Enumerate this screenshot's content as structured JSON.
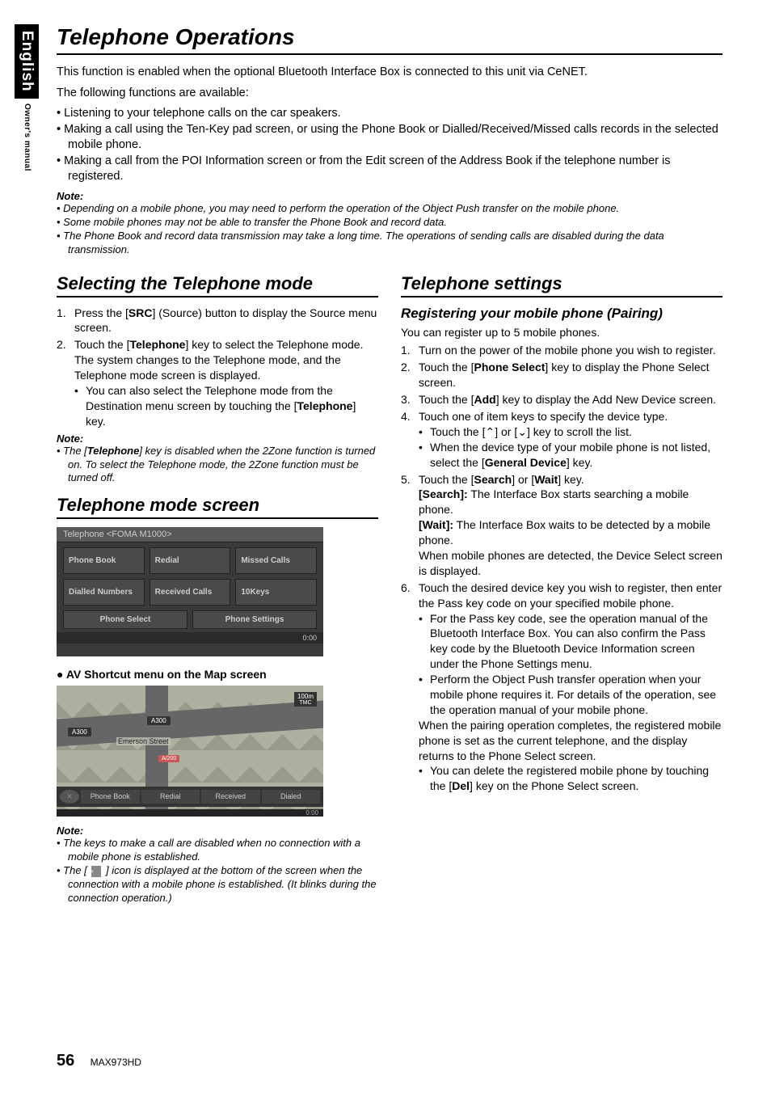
{
  "sidebar": {
    "english": "English",
    "owner": "Owner's manual"
  },
  "title": "Telephone Operations",
  "intro_l1": "This function is enabled when the optional Bluetooth Interface Box is connected to this unit via CeNET.",
  "intro_l2": "The following functions are available:",
  "top_bullets": [
    "Listening to your telephone calls on the car speakers.",
    "Making a call using the Ten-Key pad screen, or using the Phone Book or Dialled/Received/Missed calls records in the selected mobile phone.",
    "Making a call from the POI Information screen or from the Edit screen of the Address Book if the telephone number is registered."
  ],
  "note_label": "Note:",
  "top_notes": [
    "Depending on a mobile phone, you may need to perform the operation of the Object Push transfer on the mobile phone.",
    "Some mobile phones may not be able to transfer the Phone Book and record data.",
    "The Phone Book and record data transmission may take a long time. The operations of sending calls are disabled during the data transmission."
  ],
  "left": {
    "h2a": "Selecting the Telephone mode",
    "step1_pre": "Press the [",
    "step1_key": "SRC",
    "step1_post": "] (Source) button to display the Source menu screen.",
    "step2_pre": "Touch the [",
    "step2_key": "Telephone",
    "step2_post": "] key to select the Telephone mode.",
    "step2_body": "The system changes to the Telephone mode, and the Telephone mode screen is displayed.",
    "step2_sub_pre": "You can also select the Telephone mode from the Destination menu screen by touching the [",
    "step2_sub_key": "Telephone",
    "step2_sub_post": "] key.",
    "note1_pre": "The [",
    "note1_key": "Telephone",
    "note1_post": "] key is disabled when the 2Zone function is turned on. To select the Telephone mode, the 2Zone function must be turned off.",
    "h2b": "Telephone mode screen",
    "tel_shot": {
      "titlebar": "Telephone <FOMA M1000>",
      "cells": [
        "Phone Book",
        "Redial",
        "Missed Calls",
        "Dialled Numbers",
        "Received Calls",
        "10Keys"
      ],
      "bottom": [
        "Phone Select",
        "Phone Settings"
      ],
      "time": "0:00"
    },
    "shortcut_h": "AV Shortcut menu on the Map screen",
    "map_shot": {
      "badge1": "A300",
      "badge2": "A300",
      "street": "Emerson Street",
      "zoom": "100m",
      "tmc": "TMC",
      "car": "A/200",
      "toolbar": [
        "Phone Book",
        "Redial",
        "Received",
        "Dialed"
      ],
      "time": "0:00"
    },
    "note2a": "The keys to make a call are disabled when no connection with a mobile phone is established.",
    "note2b_pre": "The [ ",
    "note2b_post": " ] icon is displayed at the bottom of the screen when the connection with a mobile phone is established. (It blinks during the connection operation.)",
    "bt_glyph": "⌖"
  },
  "right": {
    "h2": "Telephone settings",
    "h3": "Registering your mobile phone (Pairing)",
    "intro": "You can register up to 5 mobile phones.",
    "s1": "Turn on the power of the mobile phone you wish to register.",
    "s2_pre": "Touch the [",
    "s2_key": "Phone Select",
    "s2_post": "] key to display the Phone Select screen.",
    "s3_pre": "Touch the [",
    "s3_key": "Add",
    "s3_post": "] key to display the Add New Device screen.",
    "s4": "Touch one of item keys to specify the device type.",
    "s4_sub1_pre": "Touch the [",
    "s4_sub1_mid": "] or [",
    "s4_sub1_post": "] key to scroll the list.",
    "s4_sub2_pre": "When the device type of your mobile phone is not listed, select the [",
    "s4_sub2_key": "General Device",
    "s4_sub2_post": "] key.",
    "s5_pre": "Touch the [",
    "s5_key1": "Search",
    "s5_mid": "] or [",
    "s5_key2": "Wait",
    "s5_post": "] key.",
    "s5_search_lbl": "[Search]:",
    "s5_search_txt": " The Interface Box starts searching a mobile phone.",
    "s5_wait_lbl": "[Wait]:",
    "s5_wait_txt": " The Interface Box waits to be detected by a mobile phone.",
    "s5_after": "When mobile phones are detected, the Device Select screen is displayed.",
    "s6": "Touch the desired device key you wish to register, then enter the Pass key code on your specified mobile phone.",
    "s6_sub1": "For the Pass key code, see the operation manual of the Bluetooth Interface Box. You can also confirm the Pass key code by the Bluetooth Device Information screen under the Phone Settings menu.",
    "s6_sub2": "Perform the Object Push transfer operation when your mobile phone requires it. For details of the operation, see the operation manual of your mobile phone.",
    "s6_after": "When the pairing operation completes, the registered mobile phone is set as the current telephone, and the display returns to the Phone Select screen.",
    "s6_sub3_pre": "You can delete the registered mobile phone by touching the [",
    "s6_sub3_key": "Del",
    "s6_sub3_post": "] key on the Phone Select screen."
  },
  "footer": {
    "page": "56",
    "model": "MAX973HD"
  }
}
